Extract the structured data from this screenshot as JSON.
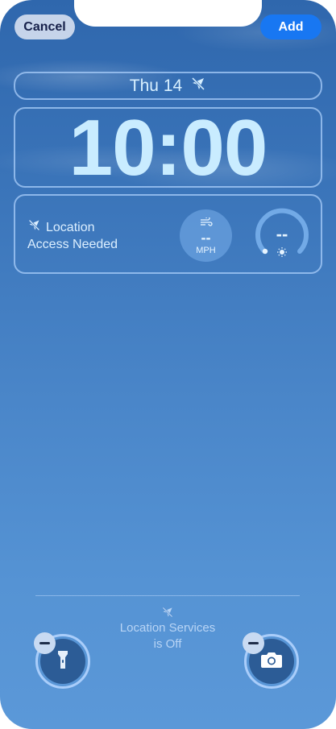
{
  "header": {
    "cancel_label": "Cancel",
    "add_label": "Add"
  },
  "date_widget": {
    "text": "Thu 14",
    "icon": "location-disabled-icon"
  },
  "clock": {
    "time": "10:00"
  },
  "widgets": {
    "location": {
      "line1": "Location",
      "line2": "Access Needed",
      "icon": "location-disabled-icon"
    },
    "wind": {
      "value": "--",
      "unit": "MPH",
      "icon": "wind-icon"
    },
    "uv_gauge": {
      "value": "--",
      "icon": "sun-icon"
    }
  },
  "footer": {
    "status_line1": "Location Services",
    "status_line2": "is Off",
    "status_icon": "location-disabled-icon",
    "left_action": "flashlight-icon",
    "right_action": "camera-icon"
  },
  "colors": {
    "accent": "#1877f2",
    "widget_border": "#aacdfa",
    "clock": "#c9ecff"
  }
}
